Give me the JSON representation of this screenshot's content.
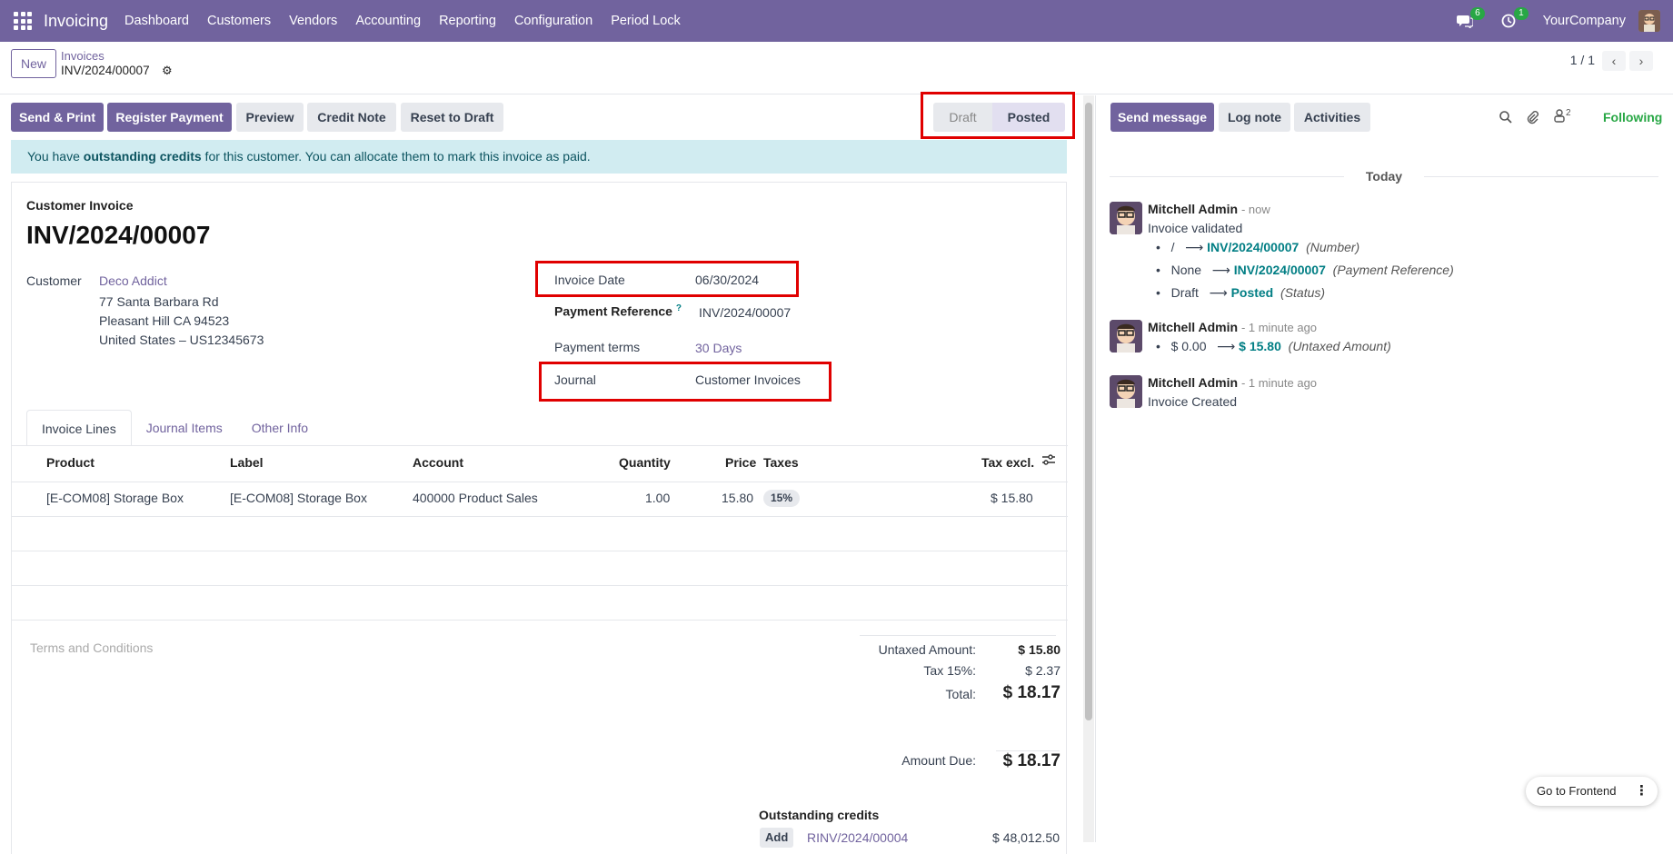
{
  "navbar": {
    "app_name": "Invoicing",
    "menus": [
      "Dashboard",
      "Customers",
      "Vendors",
      "Accounting",
      "Reporting",
      "Configuration",
      "Period Lock"
    ],
    "messages_count": "6",
    "activities_count": "1",
    "company": "YourCompany"
  },
  "control": {
    "new_label": "New",
    "breadcrumb_parent": "Invoices",
    "breadcrumb_current": "INV/2024/00007",
    "pager": "1 / 1"
  },
  "actions": {
    "send_print": "Send & Print",
    "register_payment": "Register Payment",
    "preview": "Preview",
    "credit_note": "Credit Note",
    "reset_draft": "Reset to Draft"
  },
  "status": {
    "draft": "Draft",
    "posted": "Posted"
  },
  "alert": {
    "prefix": "You have ",
    "bold": "outstanding credits",
    "suffix": " for this customer. You can allocate them to mark this invoice as paid."
  },
  "invoice": {
    "type": "Customer Invoice",
    "number": "INV/2024/00007",
    "customer_label": "Customer",
    "customer_name": "Deco Addict",
    "address1": "77 Santa Barbara Rd",
    "address2": "Pleasant Hill CA 94523",
    "address3": "United States – US12345673",
    "invoice_date_label": "Invoice Date",
    "invoice_date": "06/30/2024",
    "payment_ref_label": "Payment Reference",
    "payment_ref_help": "?",
    "payment_ref": "INV/2024/00007",
    "payment_terms_label": "Payment terms",
    "payment_terms": "30 Days",
    "journal_label": "Journal",
    "journal": "Customer Invoices"
  },
  "tabs": [
    "Invoice Lines",
    "Journal Items",
    "Other Info"
  ],
  "lines": {
    "headers": [
      "Product",
      "Label",
      "Account",
      "Quantity",
      "Price",
      "Taxes",
      "Tax excl."
    ],
    "rows": [
      {
        "product": "[E-COM08] Storage Box",
        "label": "[E-COM08] Storage Box",
        "account": "400000 Product Sales",
        "quantity": "1.00",
        "price": "15.80",
        "tax": "15%",
        "subtotal": "$ 15.80"
      }
    ]
  },
  "terms_placeholder": "Terms and Conditions",
  "totals": {
    "untaxed_label": "Untaxed Amount:",
    "untaxed": "$ 15.80",
    "tax_label": "Tax 15%:",
    "tax": "$ 2.37",
    "total_label": "Total:",
    "total": "$ 18.17",
    "due_label": "Amount Due:",
    "due": "$ 18.17"
  },
  "outstanding": {
    "title": "Outstanding credits",
    "add_label": "Add",
    "ref": "RINV/2024/00004",
    "amount": "$ 48,012.50"
  },
  "chatter": {
    "send_message": "Send message",
    "log_note": "Log note",
    "activities": "Activities",
    "followers_count": "2",
    "following": "Following",
    "today": "Today",
    "messages": [
      {
        "author": "Mitchell Admin",
        "time": "- now",
        "body": "Invoice validated",
        "changes": [
          {
            "old": "/",
            "new": "INV/2024/00007",
            "field": "(Number)"
          },
          {
            "old": "None",
            "new": "INV/2024/00007",
            "field": "(Payment Reference)"
          },
          {
            "old": "Draft",
            "new": "Posted",
            "field": "(Status)"
          }
        ]
      },
      {
        "author": "Mitchell Admin",
        "time": "- 1 minute ago",
        "changes": [
          {
            "old": "$ 0.00",
            "new": "$ 15.80",
            "field": "(Untaxed Amount)"
          }
        ]
      },
      {
        "author": "Mitchell Admin",
        "time": "- 1 minute ago",
        "body": "Invoice Created"
      }
    ]
  },
  "frontend_label": "Go to Frontend",
  "colors": {
    "brand": "#71639e",
    "alert_bg": "#d1ecf1",
    "highlight": "#e00000",
    "teal": "#017e84"
  }
}
